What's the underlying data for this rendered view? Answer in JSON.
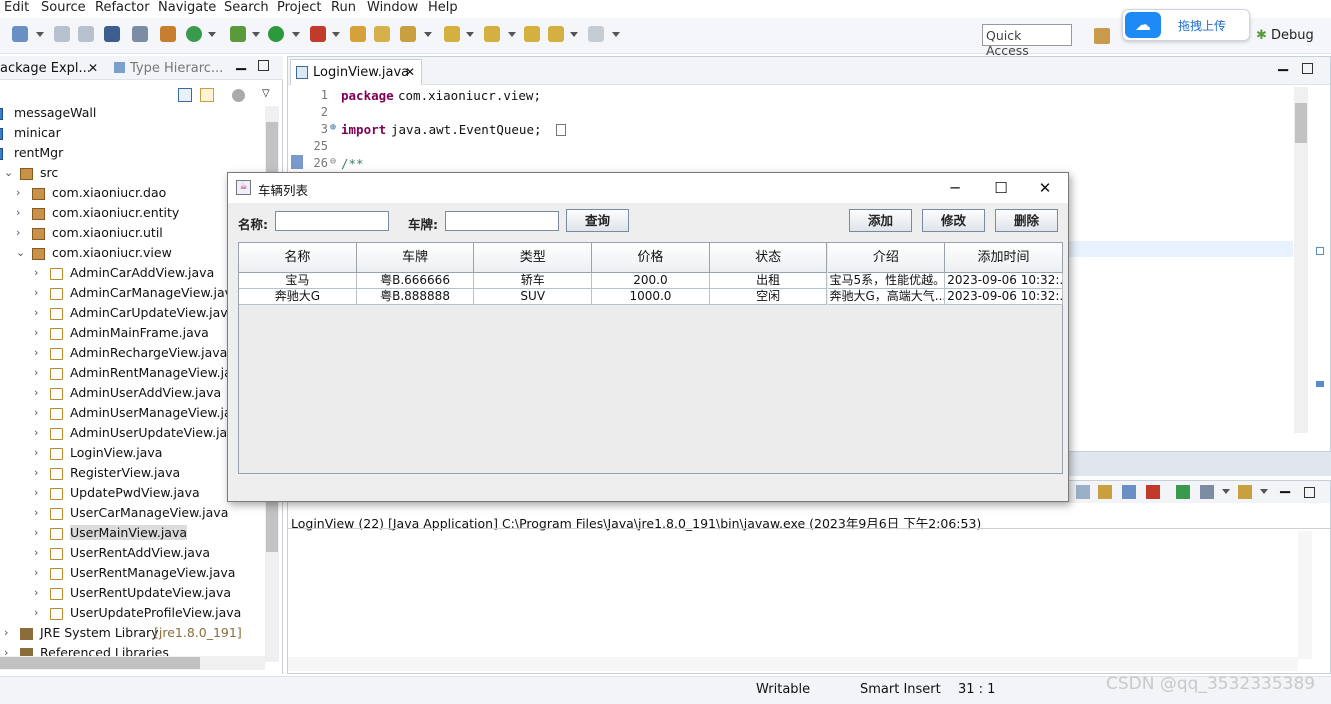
{
  "menu": [
    "Edit",
    "Source",
    "Refactor",
    "Navigate",
    "Search",
    "Project",
    "Run",
    "Window",
    "Help"
  ],
  "toolbar": {
    "quick_access": "Quick Access",
    "upload_label": "拖拽上传",
    "debug_label": "Debug"
  },
  "package_explorer": {
    "tabs": [
      "ackage Expl...",
      "Type Hierarc..."
    ],
    "items": [
      {
        "label": "messageWall",
        "indent": 0,
        "icon": "project",
        "expanded": null
      },
      {
        "label": "minicar",
        "indent": 0,
        "icon": "project",
        "expanded": null
      },
      {
        "label": "rentMgr",
        "indent": 0,
        "icon": "project",
        "expanded": null
      },
      {
        "label": "src",
        "indent": 1,
        "icon": "source-folder",
        "expanded": true
      },
      {
        "label": "com.xiaoniucr.dao",
        "indent": 2,
        "icon": "package",
        "expanded": false
      },
      {
        "label": "com.xiaoniucr.entity",
        "indent": 2,
        "icon": "package",
        "expanded": false
      },
      {
        "label": "com.xiaoniucr.util",
        "indent": 2,
        "icon": "package",
        "expanded": false
      },
      {
        "label": "com.xiaoniucr.view",
        "indent": 2,
        "icon": "package",
        "expanded": true
      },
      {
        "label": "AdminCarAddView.java",
        "indent": 3,
        "icon": "java-file",
        "expanded": false
      },
      {
        "label": "AdminCarManageView.java",
        "indent": 3,
        "icon": "java-file",
        "expanded": false
      },
      {
        "label": "AdminCarUpdateView.java",
        "indent": 3,
        "icon": "java-file",
        "expanded": false
      },
      {
        "label": "AdminMainFrame.java",
        "indent": 3,
        "icon": "java-file",
        "expanded": false
      },
      {
        "label": "AdminRechargeView.java",
        "indent": 3,
        "icon": "java-file",
        "expanded": false
      },
      {
        "label": "AdminRentManageView.java",
        "indent": 3,
        "icon": "java-file",
        "expanded": false
      },
      {
        "label": "AdminUserAddView.java",
        "indent": 3,
        "icon": "java-file",
        "expanded": false
      },
      {
        "label": "AdminUserManageView.java",
        "indent": 3,
        "icon": "java-file",
        "expanded": false
      },
      {
        "label": "AdminUserUpdateView.java",
        "indent": 3,
        "icon": "java-file",
        "expanded": false
      },
      {
        "label": "LoginView.java",
        "indent": 3,
        "icon": "java-file",
        "expanded": false
      },
      {
        "label": "RegisterView.java",
        "indent": 3,
        "icon": "java-file",
        "expanded": false
      },
      {
        "label": "UpdatePwdView.java",
        "indent": 3,
        "icon": "java-file",
        "expanded": false
      },
      {
        "label": "UserCarManageView.java",
        "indent": 3,
        "icon": "java-file",
        "expanded": false
      },
      {
        "label": "UserMainView.java",
        "indent": 3,
        "icon": "java-file",
        "expanded": false,
        "selected": true
      },
      {
        "label": "UserRentAddView.java",
        "indent": 3,
        "icon": "java-file",
        "expanded": false
      },
      {
        "label": "UserRentManageView.java",
        "indent": 3,
        "icon": "java-file",
        "expanded": false
      },
      {
        "label": "UserRentUpdateView.java",
        "indent": 3,
        "icon": "java-file",
        "expanded": false
      },
      {
        "label": "UserUpdateProfileView.java",
        "indent": 3,
        "icon": "java-file",
        "expanded": false
      },
      {
        "label": "JRE System Library",
        "suffix": "[jre1.8.0_191]",
        "indent": 1,
        "icon": "library",
        "expanded": false
      },
      {
        "label": "Referenced Libraries",
        "indent": 1,
        "icon": "library",
        "expanded": false
      }
    ]
  },
  "editor": {
    "tab_label": "LoginView.java",
    "lines": [
      {
        "num": "1",
        "keyword": "package",
        "rest": " com.xiaoniucr.view;"
      },
      {
        "num": "2",
        "keyword": "",
        "rest": ""
      },
      {
        "num": "3",
        "keyword": "import",
        "rest": " java.awt.EventQueue;"
      },
      {
        "num": "25",
        "keyword": "",
        "rest": ""
      },
      {
        "num": "26",
        "keyword": "",
        "rest": "/**"
      }
    ]
  },
  "console": {
    "text": "LoginView (22) [Java Application] C:\\Program Files\\Java\\jre1.8.0_191\\bin\\javaw.exe (2023年9月6日 下午2:06:53)"
  },
  "status": {
    "writable": "Writable",
    "insert_mode": "Smart Insert",
    "position": "31 : 1"
  },
  "watermark": "CSDN @qq_3532335389",
  "dialog": {
    "title": "车辆列表",
    "name_label": "名称:",
    "plate_label": "车牌:",
    "name_value": "",
    "plate_value": "",
    "query_button": "查询",
    "add_button": "添加",
    "edit_button": "修改",
    "delete_button": "删除",
    "table": {
      "columns": [
        "名称",
        "车牌",
        "类型",
        "价格",
        "状态",
        "介绍",
        "添加时间"
      ],
      "rows": [
        [
          "宝马",
          "粤B.666666",
          "轿车",
          "200.0",
          "出租",
          "宝马5系，性能优越。",
          "2023-09-06 10:32:..."
        ],
        [
          "奔驰大G",
          "粤B.888888",
          "SUV",
          "1000.0",
          "空闲",
          "奔驰大G，高端大气...",
          "2023-09-06 10:32:..."
        ]
      ]
    }
  }
}
